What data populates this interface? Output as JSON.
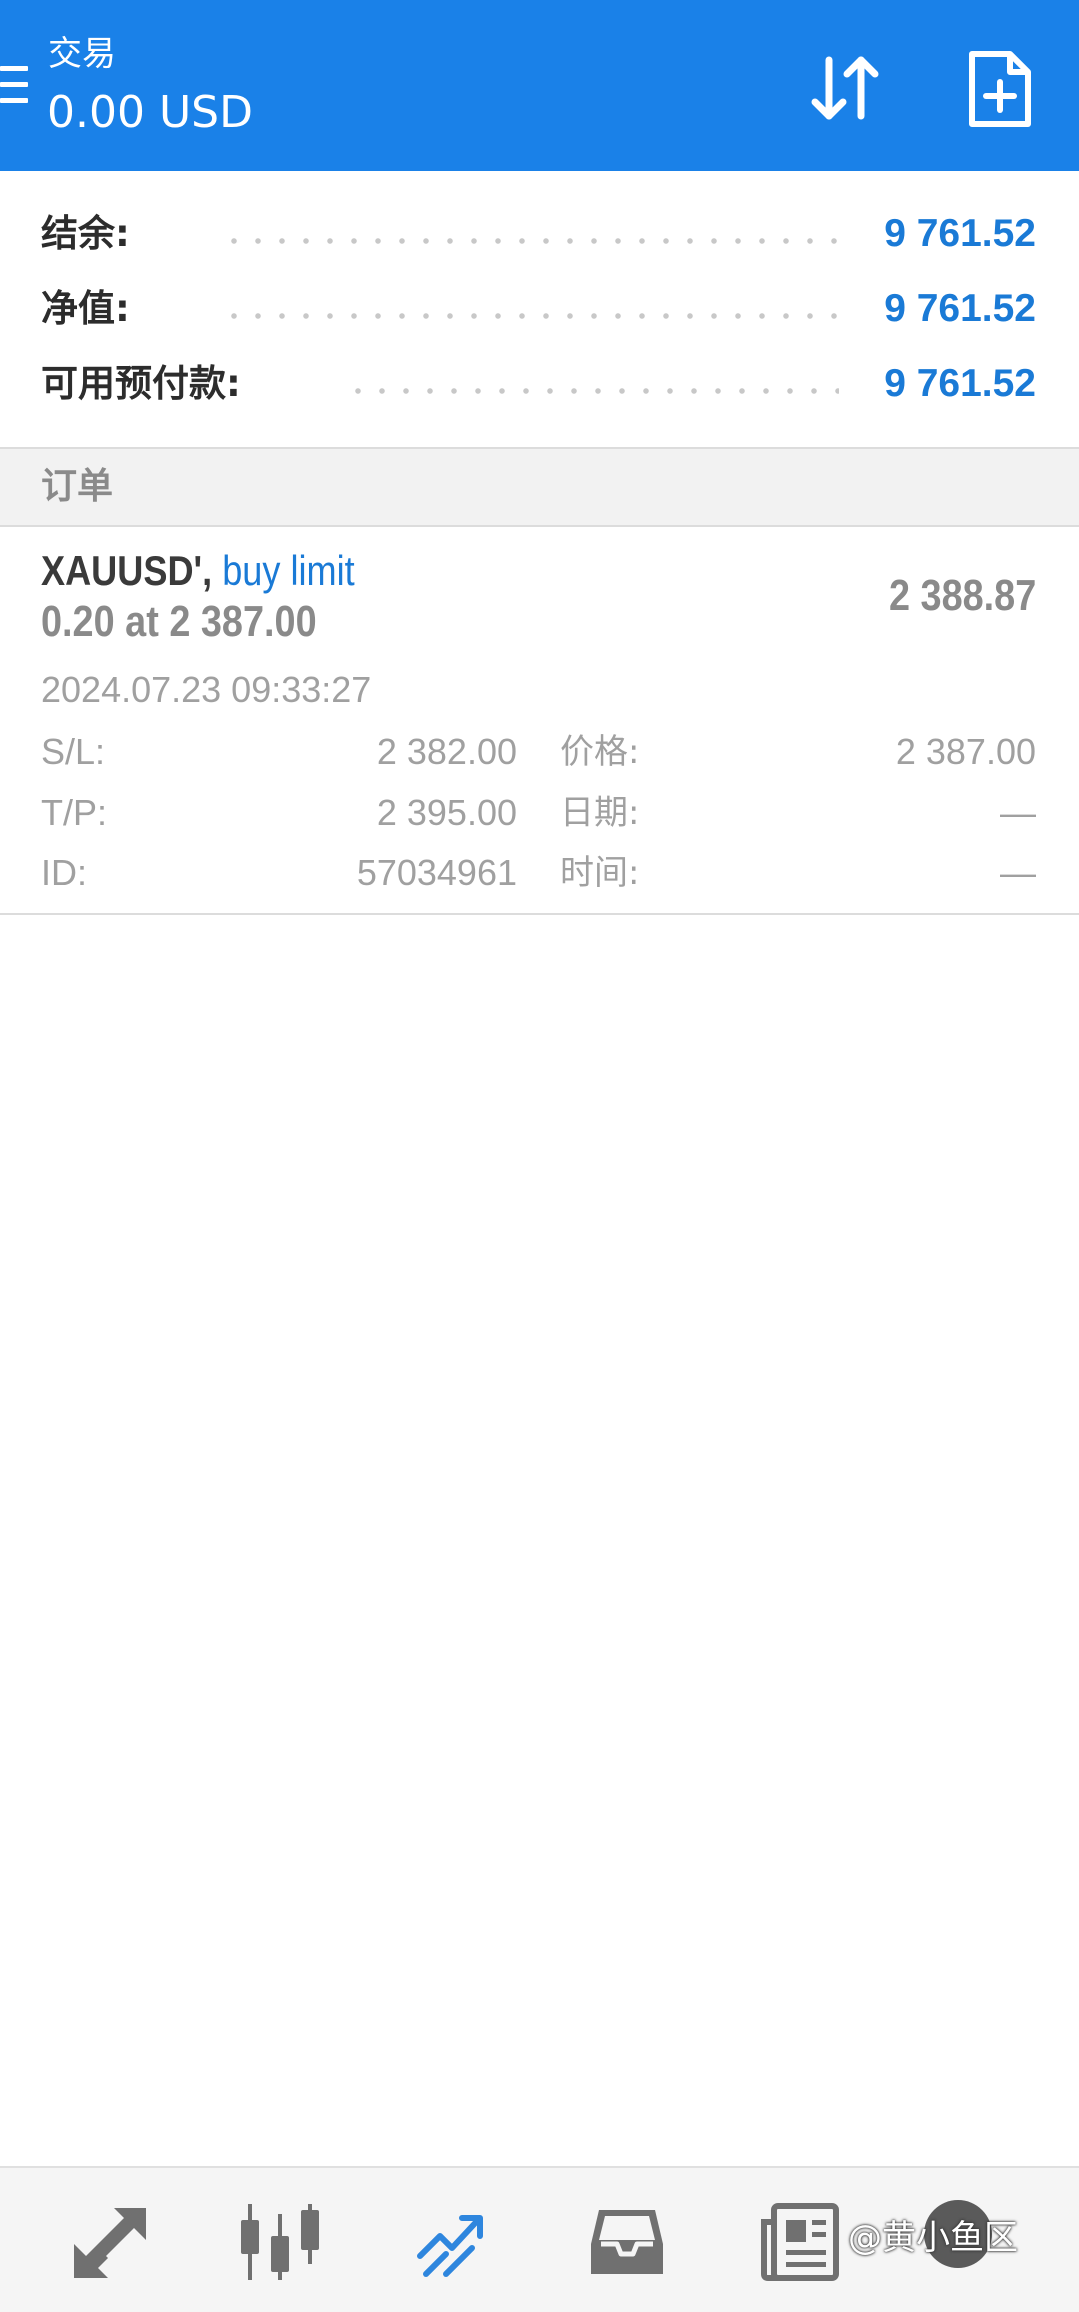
{
  "appbar": {
    "title": "交易",
    "subtitle": "0.00 USD"
  },
  "summary": {
    "rows": [
      {
        "label": "结余:",
        "value": "9 761.52"
      },
      {
        "label": "净值:",
        "value": "9 761.52"
      },
      {
        "label": "可用预付款:",
        "value": "9 761.52"
      }
    ]
  },
  "orders": {
    "header": "订单",
    "items": [
      {
        "symbol": "XAUUSD',",
        "type": "buy limit",
        "volume_line": "0.20 at 2 387.00",
        "current_price": "2 388.87",
        "time": "2024.07.23 09:33:27",
        "details": [
          {
            "k1": "S/L:",
            "v1": "2 382.00",
            "k2": "价格:",
            "v2": "2 387.00"
          },
          {
            "k1": "T/P:",
            "v1": "2 395.00",
            "k2": "日期:",
            "v2": "—"
          },
          {
            "k1": "ID:",
            "v1": "57034961",
            "k2": "时间:",
            "v2": "—"
          }
        ]
      }
    ]
  },
  "watermark": "@黄小鱼区",
  "colors": {
    "appbar": "#1a81e8",
    "accent": "#1a7ad6",
    "muted": "#a0a0a0"
  },
  "icons": {
    "menu": "menu-icon",
    "sort": "sort-arrows-icon",
    "add": "new-order-icon",
    "nav": [
      "quotes-icon",
      "chart-icon",
      "trade-icon",
      "history-icon",
      "news-icon",
      "chat-icon"
    ]
  }
}
